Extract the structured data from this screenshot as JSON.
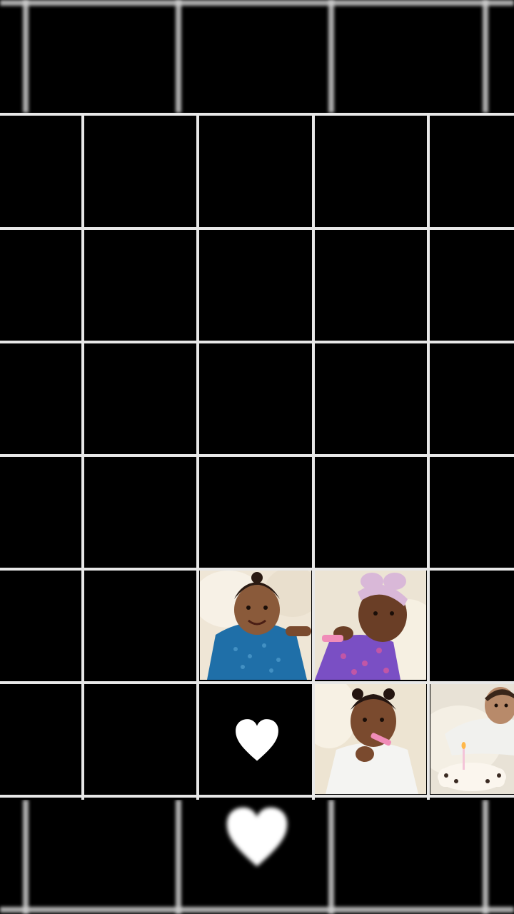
{
  "screen": {
    "background": "#000000",
    "grid_line_color": "#e8e8e8"
  },
  "tiles": [
    {
      "name": "baby-photo-blue-dress",
      "dress_color": "#1f6fa8"
    },
    {
      "name": "baby-photo-purple-dress-headband",
      "dress_color": "#7a4fc4"
    },
    {
      "name": "baby-photo-white-outfit",
      "dress_color": "#f4f4f2"
    },
    {
      "name": "baby-photo-birthday-cake",
      "dress_color": "#f1f1ee"
    }
  ],
  "icons": {
    "heart": "heart-icon"
  }
}
